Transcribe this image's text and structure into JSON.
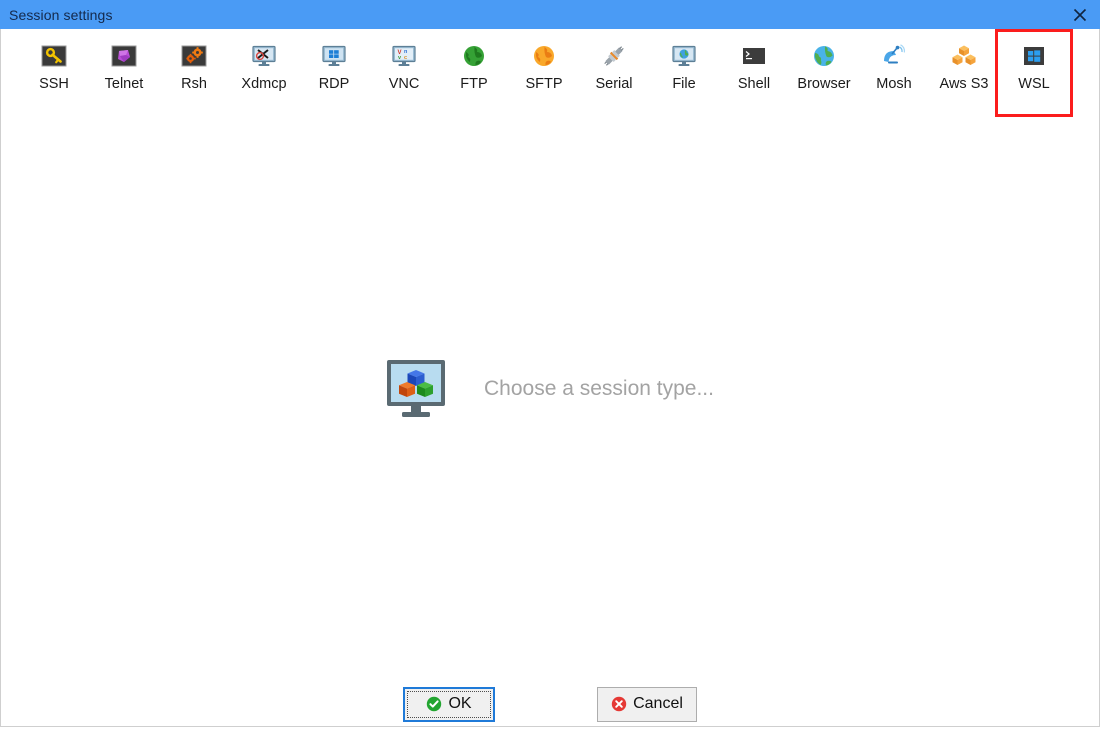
{
  "window": {
    "title": "Session settings",
    "close_icon": "close-icon"
  },
  "session_types": [
    {
      "id": "ssh",
      "label": "SSH",
      "icon": "ssh-key-icon"
    },
    {
      "id": "telnet",
      "label": "Telnet",
      "icon": "telnet-icon"
    },
    {
      "id": "rsh",
      "label": "Rsh",
      "icon": "rsh-gears-icon"
    },
    {
      "id": "xdmcp",
      "label": "Xdmcp",
      "icon": "xdmcp-monitor-icon"
    },
    {
      "id": "rdp",
      "label": "RDP",
      "icon": "rdp-monitor-icon"
    },
    {
      "id": "vnc",
      "label": "VNC",
      "icon": "vnc-monitor-icon"
    },
    {
      "id": "ftp",
      "label": "FTP",
      "icon": "ftp-green-globe-icon"
    },
    {
      "id": "sftp",
      "label": "SFTP",
      "icon": "sftp-orange-globe-icon"
    },
    {
      "id": "serial",
      "label": "Serial",
      "icon": "serial-plug-icon"
    },
    {
      "id": "file",
      "label": "File",
      "icon": "file-monitor-globe-icon"
    },
    {
      "id": "shell",
      "label": "Shell",
      "icon": "shell-terminal-icon"
    },
    {
      "id": "browser",
      "label": "Browser",
      "icon": "browser-globe-icon"
    },
    {
      "id": "mosh",
      "label": "Mosh",
      "icon": "mosh-satellite-icon"
    },
    {
      "id": "awss3",
      "label": "Aws S3",
      "icon": "aws-s3-cubes-icon"
    },
    {
      "id": "wsl",
      "label": "WSL",
      "icon": "wsl-windows-icon",
      "highlighted": true
    }
  ],
  "placeholder": {
    "icon": "monitor-cubes-icon",
    "text": "Choose a session type..."
  },
  "buttons": {
    "ok": {
      "label": "OK",
      "icon": "check-circle-icon"
    },
    "cancel": {
      "label": "Cancel",
      "icon": "error-circle-icon"
    }
  },
  "colors": {
    "titlebar": "#4a9bf5",
    "titlebar_text": "#14294b",
    "highlight_box": "#fb1d1d",
    "placeholder_text": "#a3a3a3",
    "ok_focus_border": "#1f7ad8",
    "ok_icon_green": "#2eb82e",
    "cancel_icon_red": "#e63232"
  }
}
